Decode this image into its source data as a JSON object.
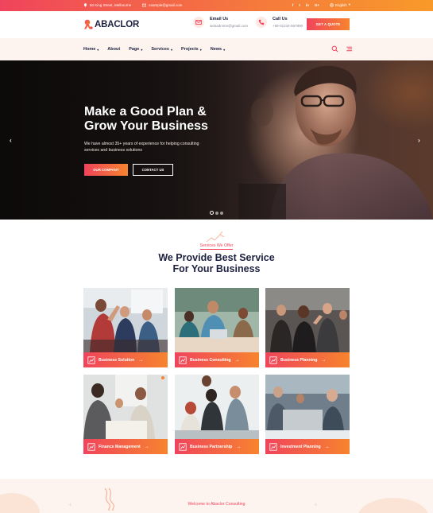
{
  "topbar": {
    "address": "50 King Street, Melbourne",
    "email": "example@gmail.com",
    "social": [
      "f",
      "t",
      "in",
      "G+"
    ],
    "language": "English"
  },
  "header": {
    "logo_text": "ABACLOR",
    "email_title": "Email Us",
    "email_value": "webadmine@gmail.com",
    "call_title": "Call Us",
    "call_value": "+98-01234-567890",
    "quote_label": "GET A QUOTE"
  },
  "nav": {
    "items": [
      {
        "label": "Home",
        "caret": true
      },
      {
        "label": "About",
        "caret": false
      },
      {
        "label": "Page",
        "caret": true
      },
      {
        "label": "Services",
        "caret": true
      },
      {
        "label": "Projects",
        "caret": true
      },
      {
        "label": "News",
        "caret": true
      }
    ]
  },
  "hero": {
    "title_line1": "Make a Good Plan &",
    "title_line2": "Grow Your Business",
    "text": "We have almost 35+ years of experience for helping consulting services and business solutions",
    "btn_primary": "OUR COMPANY",
    "btn_secondary": "CONTACT US",
    "slides": 3,
    "active_slide": 1
  },
  "services": {
    "subtitle": "Services We Offer",
    "title_line1": "We Provide Best Service",
    "title_line2": "For Your Business",
    "cards": [
      {
        "label": "Business Solution"
      },
      {
        "label": "Business Consulting"
      },
      {
        "label": "Business Planning"
      },
      {
        "label": "Finance Management"
      },
      {
        "label": "Business Partnership"
      },
      {
        "label": "Investment Planning"
      }
    ]
  },
  "welcome": {
    "label": "Welcome to Abaclor Consulting"
  },
  "colors": {
    "accent_start": "#f0445c",
    "accent_end": "#f7842e",
    "heading": "#1d2140"
  }
}
